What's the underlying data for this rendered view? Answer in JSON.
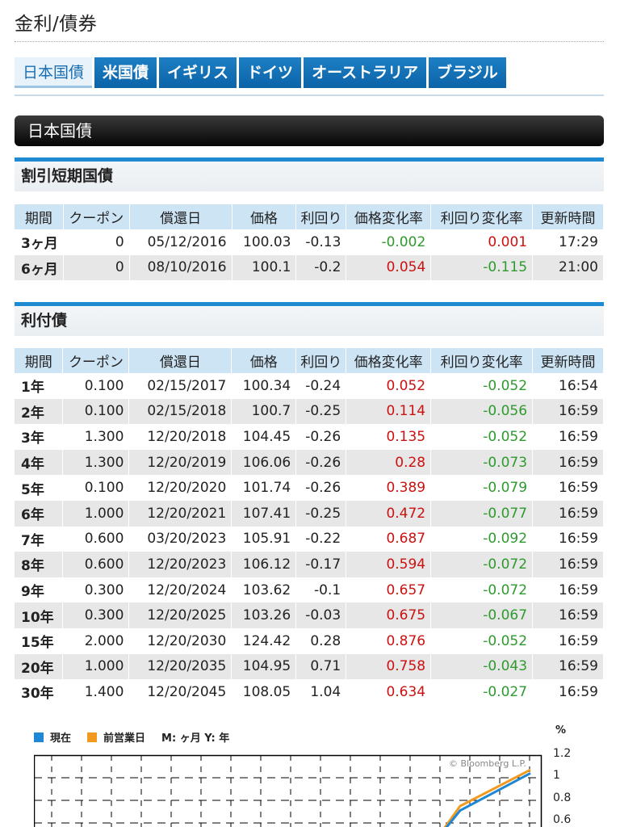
{
  "page": {
    "title": "金利/債券"
  },
  "tabs": [
    {
      "label": "日本国債",
      "active": true
    },
    {
      "label": "米国債",
      "active": false
    },
    {
      "label": "イギリス",
      "active": false
    },
    {
      "label": "ドイツ",
      "active": false
    },
    {
      "label": "オーストラリア",
      "active": false
    },
    {
      "label": "ブラジル",
      "active": false
    }
  ],
  "section": {
    "title": "日本国債"
  },
  "columns": {
    "period": "期間",
    "coupon": "クーポン",
    "maturity": "償還日",
    "price": "価格",
    "yield": "利回り",
    "price_change": "価格変化率",
    "yield_change": "利回り変化率",
    "updated": "更新時間"
  },
  "bills": {
    "title": "割引短期国債",
    "rows": [
      {
        "period": "3ヶ月",
        "coupon": "0",
        "maturity": "05/12/2016",
        "price": "100.03",
        "yield": "-0.13",
        "price_change": "-0.002",
        "yield_change": "0.001",
        "updated": "17:29"
      },
      {
        "period": "6ヶ月",
        "coupon": "0",
        "maturity": "08/10/2016",
        "price": "100.1",
        "yield": "-0.2",
        "price_change": "0.054",
        "yield_change": "-0.115",
        "updated": "21:00"
      }
    ]
  },
  "coupon_bonds": {
    "title": "利付債",
    "rows": [
      {
        "period": "1年",
        "coupon": "0.100",
        "maturity": "02/15/2017",
        "price": "100.34",
        "yield": "-0.24",
        "price_change": "0.052",
        "yield_change": "-0.052",
        "updated": "16:54"
      },
      {
        "period": "2年",
        "coupon": "0.100",
        "maturity": "02/15/2018",
        "price": "100.7",
        "yield": "-0.25",
        "price_change": "0.114",
        "yield_change": "-0.056",
        "updated": "16:59"
      },
      {
        "period": "3年",
        "coupon": "1.300",
        "maturity": "12/20/2018",
        "price": "104.45",
        "yield": "-0.26",
        "price_change": "0.135",
        "yield_change": "-0.052",
        "updated": "16:59"
      },
      {
        "period": "4年",
        "coupon": "1.300",
        "maturity": "12/20/2019",
        "price": "106.06",
        "yield": "-0.26",
        "price_change": "0.28",
        "yield_change": "-0.073",
        "updated": "16:59"
      },
      {
        "period": "5年",
        "coupon": "0.100",
        "maturity": "12/20/2020",
        "price": "101.74",
        "yield": "-0.26",
        "price_change": "0.389",
        "yield_change": "-0.079",
        "updated": "16:59"
      },
      {
        "period": "6年",
        "coupon": "1.000",
        "maturity": "12/20/2021",
        "price": "107.41",
        "yield": "-0.25",
        "price_change": "0.472",
        "yield_change": "-0.077",
        "updated": "16:59"
      },
      {
        "period": "7年",
        "coupon": "0.600",
        "maturity": "03/20/2023",
        "price": "105.91",
        "yield": "-0.22",
        "price_change": "0.687",
        "yield_change": "-0.092",
        "updated": "16:59"
      },
      {
        "period": "8年",
        "coupon": "0.600",
        "maturity": "12/20/2023",
        "price": "106.12",
        "yield": "-0.17",
        "price_change": "0.594",
        "yield_change": "-0.072",
        "updated": "16:59"
      },
      {
        "period": "9年",
        "coupon": "0.300",
        "maturity": "12/20/2024",
        "price": "103.62",
        "yield": "-0.1",
        "price_change": "0.657",
        "yield_change": "-0.072",
        "updated": "16:59"
      },
      {
        "period": "10年",
        "coupon": "0.300",
        "maturity": "12/20/2025",
        "price": "103.26",
        "yield": "-0.03",
        "price_change": "0.675",
        "yield_change": "-0.067",
        "updated": "16:59"
      },
      {
        "period": "15年",
        "coupon": "2.000",
        "maturity": "12/20/2030",
        "price": "124.42",
        "yield": "0.28",
        "price_change": "0.876",
        "yield_change": "-0.052",
        "updated": "16:59"
      },
      {
        "period": "20年",
        "coupon": "1.000",
        "maturity": "12/20/2035",
        "price": "104.95",
        "yield": "0.71",
        "price_change": "0.758",
        "yield_change": "-0.043",
        "updated": "16:59"
      },
      {
        "period": "30年",
        "coupon": "1.400",
        "maturity": "12/20/2045",
        "price": "108.05",
        "yield": "1.04",
        "price_change": "0.634",
        "yield_change": "-0.027",
        "updated": "16:59"
      }
    ]
  },
  "colors": {
    "positive": "#cc1111",
    "negative": "#2e9a2e",
    "current": "#1e88d6",
    "previous": "#f29a1f"
  },
  "chart_data": {
    "type": "line",
    "legend": [
      "現在",
      "前営業日"
    ],
    "axis_note": "M: ヶ月 Y: 年",
    "ylabel": "%",
    "credit": "© Bloomberg L.P.",
    "ylim_visible": [
      0.5,
      1.2
    ],
    "yticks": [
      "1.2",
      "1",
      "0.8",
      "0.6"
    ],
    "series": [
      {
        "name": "現在",
        "values": [
          0.71,
          1.04
        ]
      },
      {
        "name": "前営業日",
        "values": [
          0.75,
          1.07
        ]
      }
    ]
  }
}
